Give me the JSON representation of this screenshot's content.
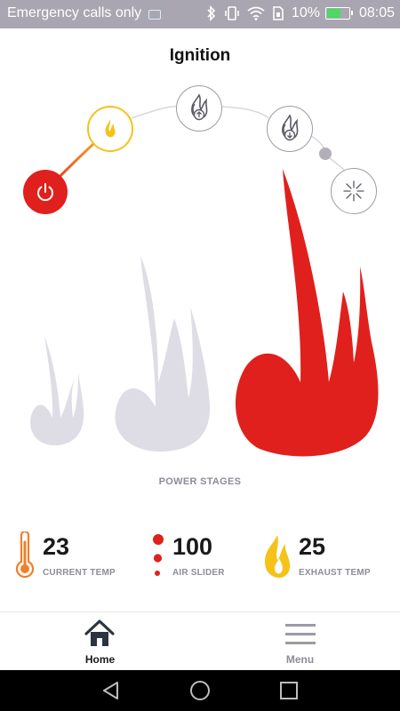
{
  "status_bar": {
    "carrier_text": "Emergency calls only",
    "battery_percent": "10%",
    "time": "08:05",
    "battery_level": 0.1
  },
  "page": {
    "title": "Ignition"
  },
  "stages": {
    "items": [
      {
        "name": "power",
        "icon": "power-icon",
        "state": "active"
      },
      {
        "name": "ignition",
        "icon": "flame-icon",
        "state": "current"
      },
      {
        "name": "power-up",
        "icon": "flame-up-icon",
        "state": "inactive"
      },
      {
        "name": "power-down",
        "icon": "flame-down-icon",
        "state": "inactive"
      },
      {
        "name": "spark",
        "icon": "spark-icon",
        "state": "inactive"
      }
    ],
    "power_stages_label": "POWER STAGES",
    "active_power_stage": 3,
    "power_stage_count": 3
  },
  "stats": {
    "current_temp": {
      "value": "23",
      "label": "CURRENT TEMP",
      "icon": "thermometer-icon"
    },
    "air_slider": {
      "value": "100",
      "label": "AIR SLIDER",
      "icon": "air-dots-icon"
    },
    "exhaust_temp": {
      "value": "25",
      "label": "EXHAUST TEMP",
      "icon": "exhaust-flame-icon"
    }
  },
  "bottom_nav": {
    "home_label": "Home",
    "menu_label": "Menu"
  },
  "colors": {
    "accent_red": "#e0201c",
    "accent_yellow": "#f5c21a",
    "accent_orange": "#f07f2a",
    "inactive_gray": "#9d9aa5",
    "flame_inactive": "#dedde6"
  }
}
